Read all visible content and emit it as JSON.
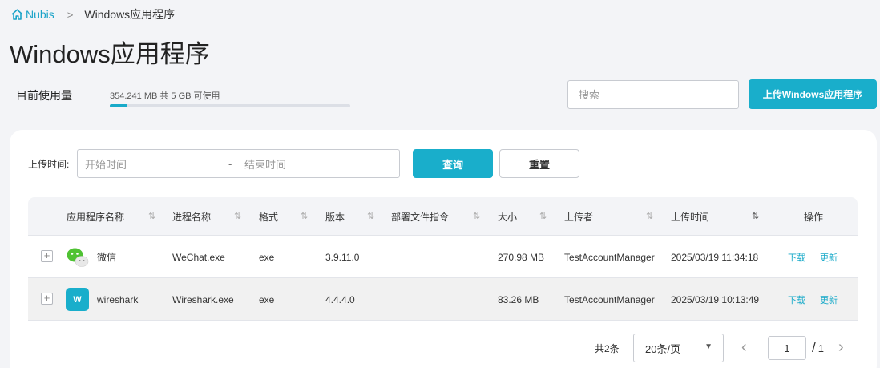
{
  "breadcrumb": {
    "home": "Nubis",
    "separator": ">",
    "current": "Windows应用程序"
  },
  "page_title": "Windows应用程序",
  "usage": {
    "label": "目前使用量",
    "text": "354.241 MB 共 5 GB 可使用",
    "fraction": 0.0692
  },
  "search": {
    "placeholder": "搜索"
  },
  "upload_button": "上传Windows应用程序",
  "filter": {
    "label": "上传时间:",
    "start_placeholder": "开始时间",
    "separator": "-",
    "end_placeholder": "结束时间",
    "query_button": "查询",
    "reset_button": "重置"
  },
  "table": {
    "columns": [
      "应用程序名称",
      "进程名称",
      "格式",
      "版本",
      "部署文件指令",
      "大小",
      "上传者",
      "上传时间",
      "操作"
    ],
    "sort_icon": "⇅",
    "rows": [
      {
        "name": "微信",
        "icon": "wechat-icon",
        "process": "WeChat.exe",
        "format": "exe",
        "version": "3.9.11.0",
        "command": "",
        "size": "270.98 MB",
        "uploader": "TestAccountManager",
        "time": "2025/03/19 11:34:18",
        "download": "下载",
        "update": "更新"
      },
      {
        "name": "wireshark",
        "icon": "wireshark-icon",
        "icon_letter": "W",
        "process": "Wireshark.exe",
        "format": "exe",
        "version": "4.4.4.0",
        "command": "",
        "size": "83.26 MB",
        "uploader": "TestAccountManager",
        "time": "2025/03/19 10:13:49",
        "download": "下载",
        "update": "更新"
      }
    ]
  },
  "pagination": {
    "total": "共2条",
    "page_size": "20条/页",
    "current_page": "1",
    "slash": "/",
    "total_pages": "1"
  },
  "colors": {
    "accent": "#19aecb",
    "background": "#f3f4f7"
  }
}
